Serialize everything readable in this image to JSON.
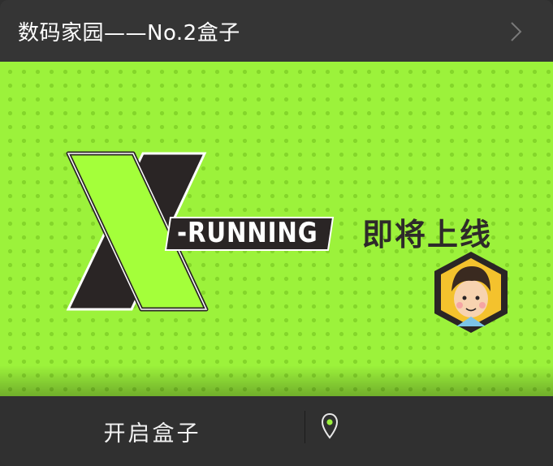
{
  "header": {
    "title": "数码家园——No.2盒子",
    "chevron_icon": "chevron-right-icon"
  },
  "banner": {
    "logo_letter": "X",
    "logo_word": "-RUNNING",
    "tagline": "即将上线",
    "mascot_icon": "mascot-avatar-icon",
    "colors": {
      "background": "#9cf23b",
      "accent": "#a4ff3a",
      "dark": "#2e2a2a"
    }
  },
  "footer": {
    "open_label": "开启盒子",
    "location_icon": "location-pin-icon"
  }
}
